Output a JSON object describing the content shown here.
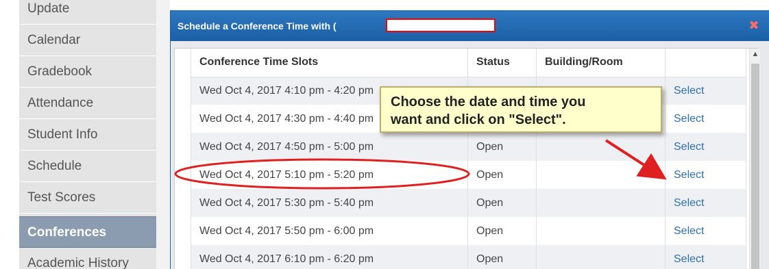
{
  "sidebar": {
    "items": [
      {
        "label": "Update",
        "active": false
      },
      {
        "label": "Calendar",
        "active": false
      },
      {
        "label": "Gradebook",
        "active": false
      },
      {
        "label": "Attendance",
        "active": false
      },
      {
        "label": "Student Info",
        "active": false
      },
      {
        "label": "Schedule",
        "active": false
      },
      {
        "label": "Test Scores",
        "active": false
      },
      {
        "label": "Conferences",
        "active": true
      },
      {
        "label": "Academic History",
        "active": false
      }
    ]
  },
  "modal": {
    "title": "Schedule a Conference Time with (",
    "close_glyph": "✖",
    "columns": [
      "Conference Time Slots",
      "Status",
      "Building/Room",
      ""
    ],
    "rows": [
      {
        "slot": "Wed Oct 4, 2017 4:10 pm - 4:20 pm",
        "status": "",
        "room": "",
        "action": "Select"
      },
      {
        "slot": "Wed Oct 4, 2017 4:30 pm - 4:40 pm",
        "status": "",
        "room": "",
        "action": "Select"
      },
      {
        "slot": "Wed Oct 4, 2017 4:50 pm - 5:00 pm",
        "status": "Open",
        "room": "",
        "action": "Select"
      },
      {
        "slot": "Wed Oct 4, 2017 5:10 pm - 5:20 pm",
        "status": "Open",
        "room": "",
        "action": "Select"
      },
      {
        "slot": "Wed Oct 4, 2017 5:30 pm - 5:40 pm",
        "status": "Open",
        "room": "",
        "action": "Select"
      },
      {
        "slot": "Wed Oct 4, 2017 5:50 pm - 6:00 pm",
        "status": "Open",
        "room": "",
        "action": "Select"
      },
      {
        "slot": "Wed Oct 4, 2017 6:10 pm - 6:20 pm",
        "status": "Open",
        "room": "",
        "action": "Select"
      }
    ]
  },
  "callout": {
    "line1": "Choose the date and time you",
    "line2": "want  and click on \"Select\"."
  },
  "colors": {
    "header_blue": "#1a5fa5",
    "sidebar_active": "#8c9cb0",
    "link_blue": "#2e6fb2",
    "annotation_red": "#e02020",
    "callout_yellow": "#ffffcc"
  }
}
